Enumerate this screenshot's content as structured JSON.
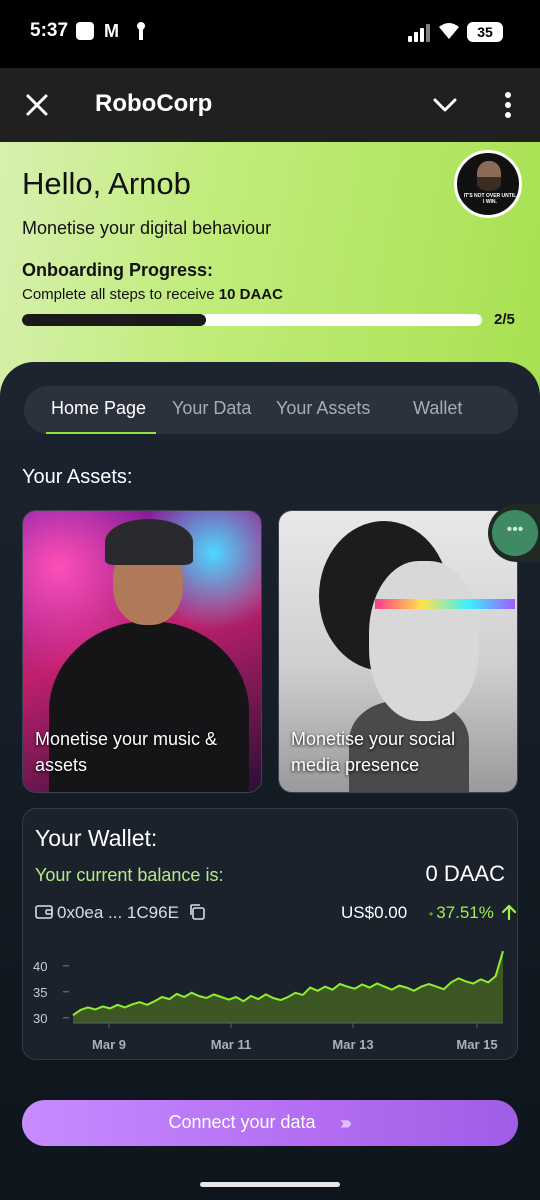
{
  "status_bar": {
    "time": "5:37",
    "battery": "35"
  },
  "app_bar": {
    "title": "RoboCorp"
  },
  "header": {
    "greeting": "Hello, Arnob",
    "tagline": "Monetise your digital behaviour",
    "onboarding_label": "Onboarding Progress:",
    "steps_text": "Complete all steps to receive ",
    "steps_reward": "10 DAAC",
    "progress_text": "2/5",
    "progress_fraction": 0.4,
    "avatar_caption": "IT'S NOT OVER UNTIL I WIN."
  },
  "tabs": [
    {
      "label": "Home Page",
      "active": true
    },
    {
      "label": "Your Data",
      "active": false
    },
    {
      "label": "Your Assets",
      "active": false
    },
    {
      "label": "Wallet",
      "active": false
    }
  ],
  "assets": {
    "heading": "Your Assets:",
    "cards": [
      {
        "label": "Monetise your music & assets"
      },
      {
        "label": "Monetise your social media presence"
      }
    ]
  },
  "wallet": {
    "heading": "Your Wallet:",
    "balance_label": "Your current balance is:",
    "balance_value": "0 DAAC",
    "address": "0x0ea ... 1C96E",
    "usd_value": "US$0.00",
    "change_pct": "37.51%",
    "accent": "#9ff04c"
  },
  "chart_data": {
    "type": "area",
    "x_ticks": [
      "Mar 9",
      "Mar 11",
      "Mar 13",
      "Mar 15"
    ],
    "y_ticks": [
      30,
      35,
      40
    ],
    "ylim": [
      29,
      44
    ],
    "values": [
      30.5,
      31.5,
      32,
      31.6,
      32.2,
      31.8,
      32.5,
      32,
      32.6,
      33,
      32.5,
      33.2,
      34,
      33.6,
      34.6,
      34,
      34.8,
      34.2,
      33.8,
      34.5,
      34,
      33.5,
      34,
      33.2,
      34.2,
      33.6,
      34.5,
      33.8,
      33.4,
      34,
      34.8,
      34.4,
      35.8,
      35.2,
      36,
      35.4,
      36.5,
      36,
      35.6,
      36.4,
      35.8,
      36.6,
      36,
      35.4,
      36.2,
      35.8,
      35.2,
      36,
      36.5,
      36,
      35.5,
      36.8,
      37.6,
      37,
      36.6,
      37.4,
      36.8,
      38,
      42.8
    ]
  },
  "cta": {
    "label": "Connect your data"
  }
}
